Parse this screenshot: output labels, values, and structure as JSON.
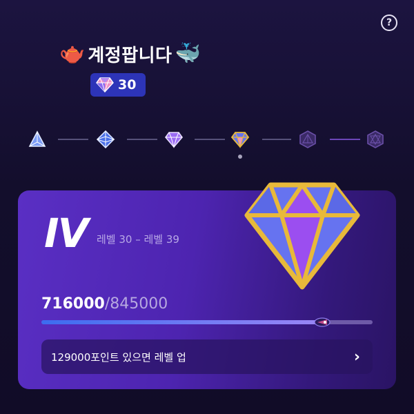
{
  "header": {
    "title": "계정팝니다",
    "left_emoji": "🫖",
    "right_emoji": "🐳",
    "help_icon": "help-circle-icon",
    "help_label": "?"
  },
  "level_badge": {
    "icon": "diamond-icon",
    "value": "30"
  },
  "tiers": {
    "icons": [
      "tier-1-triangle-icon",
      "tier-2-octahedron-icon",
      "tier-3-gem-icon",
      "tier-4-diamond-icon",
      "tier-5-locked-icon",
      "tier-6-locked-icon"
    ],
    "current_index": 3,
    "colors": {
      "line": "#56517a",
      "line_active": "#6c46b8"
    }
  },
  "card": {
    "tier_roman": "IV",
    "level_range": "레벨 30 – 레벨 39",
    "points_current": "716000",
    "points_total": "/845000",
    "progress": 0.847,
    "level_up_message": "129000포인트 있으면 레벨 업",
    "chevron": "›",
    "colors": {
      "gem_gold": "#e8b93a",
      "gem_blue": "#6673f0",
      "gem_purple": "#9b4ef0"
    }
  }
}
